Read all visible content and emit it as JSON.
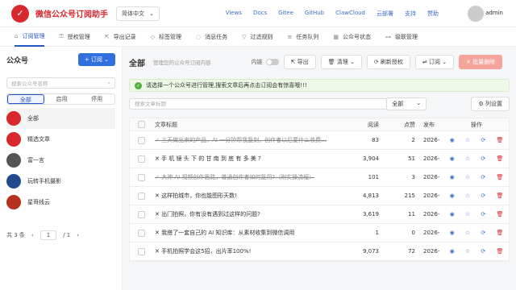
{
  "app": {
    "title": "微信公众号订阅助手",
    "language": "简体中文",
    "user": "admin"
  },
  "top_links": [
    "Views",
    "Docs",
    "Gitee",
    "GitHub",
    "ClawCloud",
    "云部署",
    "支持",
    "赞助"
  ],
  "nav": [
    {
      "label": "订阅管理",
      "active": true
    },
    {
      "label": "授权管理"
    },
    {
      "label": "导出记录"
    },
    {
      "label": "标签管理"
    },
    {
      "label": "消息任务"
    },
    {
      "label": "过滤规则"
    },
    {
      "label": "任务队列"
    },
    {
      "label": "公众号状态"
    },
    {
      "label": "级联管理"
    }
  ],
  "sidebar": {
    "title": "公众号",
    "subscribe_button": "+ 订阅 ⌄",
    "search_placeholder": "搜索公众号名称",
    "filters": [
      "全部",
      "启用",
      "停用"
    ],
    "accounts": [
      "全部",
      "精选文章",
      "富一言",
      "玩转手机摄影",
      "星哥线云"
    ],
    "pager": {
      "total": "共 3 条",
      "page": "1",
      "pages": "/ 1"
    }
  },
  "main": {
    "title": "全部",
    "subtitle": "管理您的公众号订阅内容",
    "toggle_label": "内链",
    "buttons": {
      "export": "导出",
      "clean": "清理",
      "refresh_auth": "刷新授权",
      "subscribe": "订阅",
      "unsubscribe": "批量删除"
    },
    "alert": "请选择一个公众号进行管理,搜索文章后再点击订阅会有惊喜哦!!!",
    "search_placeholder": "搜索文章标题",
    "status_select": "全部",
    "column_settings": "列设置",
    "columns": {
      "title": "文章标题",
      "read": "阅读",
      "like": "点赞",
      "date": "发布",
      "ops": "操作"
    },
    "rows": [
      {
        "title": "三天做出来的产品，AI 一分钟帮我复刻，创作者以后要什么收费…",
        "read": "83",
        "like": "2",
        "date": "2026-",
        "strike": true
      },
      {
        "title": "手 机 镜 头 下 的 甘 南 到 底 有 多 美 ?",
        "read": "3,904",
        "like": "51",
        "date": "2026-",
        "strike": false
      },
      {
        "title": "大神 AI 视频创作思路，普通创作者如何复用?（附实操流程）",
        "read": "101",
        "like": "3",
        "date": "2026-",
        "strike": true
      },
      {
        "title": "这样拍城市，你也能图形天数!",
        "read": "4,813",
        "like": "215",
        "date": "2026-",
        "strike": false
      },
      {
        "title": "出门拍照，你有没有遇到过这样的问题?",
        "read": "3,619",
        "like": "11",
        "date": "2026-",
        "strike": false
      },
      {
        "title": "我搭了一套自己的 AI 知识库：从素材收集到微信调用",
        "read": "1",
        "like": "0",
        "date": "2026-",
        "strike": false
      },
      {
        "title": "手机拍照学会这5招，出片率100%!",
        "read": "9,073",
        "like": "72",
        "date": "2026-",
        "strike": false
      }
    ]
  }
}
